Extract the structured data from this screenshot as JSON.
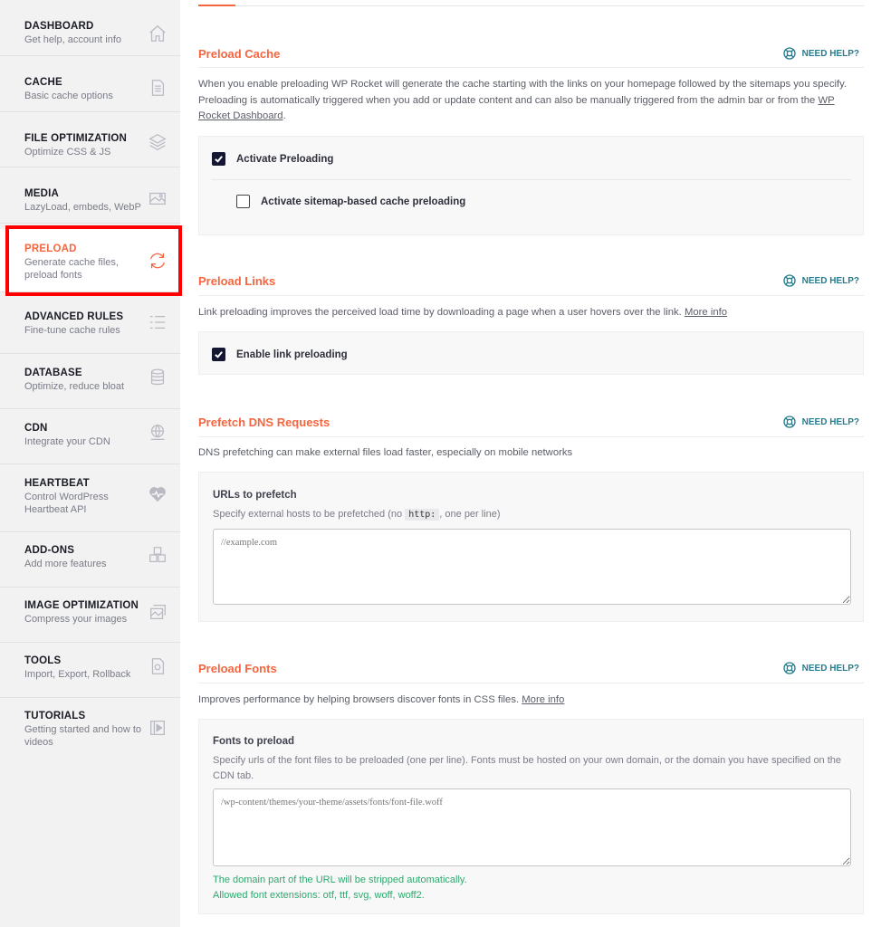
{
  "sidebar": {
    "items": [
      {
        "title": "DASHBOARD",
        "sub": "Get help, account info",
        "icon": "home-icon"
      },
      {
        "title": "CACHE",
        "sub": "Basic cache options",
        "icon": "document-icon"
      },
      {
        "title": "FILE OPTIMIZATION",
        "sub": "Optimize CSS & JS",
        "icon": "layers-icon"
      },
      {
        "title": "MEDIA",
        "sub": "LazyLoad, embeds, WebP",
        "icon": "image-icon"
      },
      {
        "title": "PRELOAD",
        "sub": "Generate cache files, preload fonts",
        "icon": "refresh-icon"
      },
      {
        "title": "ADVANCED RULES",
        "sub": "Fine-tune cache rules",
        "icon": "list-icon"
      },
      {
        "title": "DATABASE",
        "sub": "Optimize, reduce bloat",
        "icon": "database-icon"
      },
      {
        "title": "CDN",
        "sub": "Integrate your CDN",
        "icon": "globe-icon"
      },
      {
        "title": "HEARTBEAT",
        "sub": "Control WordPress Heartbeat API",
        "icon": "heart-pulse-icon"
      },
      {
        "title": "ADD-ONS",
        "sub": "Add more features",
        "icon": "cubes-icon"
      },
      {
        "title": "IMAGE OPTIMIZATION",
        "sub": "Compress your images",
        "icon": "image-compress-icon"
      },
      {
        "title": "TOOLS",
        "sub": "Import, Export, Rollback",
        "icon": "file-gear-icon"
      },
      {
        "title": "TUTORIALS",
        "sub": "Getting started and how to videos",
        "icon": "video-icon"
      }
    ],
    "active_index": 4
  },
  "help_label": "NEED HELP?",
  "preload_cache": {
    "title": "Preload Cache",
    "desc": "When you enable preloading WP Rocket will generate the cache starting with the links on your homepage followed by the sitemaps you specify. Preloading is automatically triggered when you add or update content and can also be manually triggered from the admin bar or from the ",
    "desc_link": "WP Rocket Dashboard",
    "desc_end": ".",
    "activate_label": "Activate Preloading",
    "activate_checked": true,
    "sitemap_label": "Activate sitemap-based cache preloading",
    "sitemap_checked": false
  },
  "preload_links": {
    "title": "Preload Links",
    "desc": "Link preloading improves the perceived load time by downloading a page when a user hovers over the link. ",
    "desc_link": "More info",
    "enable_label": "Enable link preloading",
    "enable_checked": true
  },
  "prefetch_dns": {
    "title": "Prefetch DNS Requests",
    "desc": "DNS prefetching can make external files load faster, especially on mobile networks",
    "field_label": "URLs to prefetch",
    "help_before": "Specify external hosts to be prefetched (no ",
    "help_code": "http:",
    "help_after": ", one per line)",
    "placeholder": "//example.com"
  },
  "preload_fonts": {
    "title": "Preload Fonts",
    "desc": "Improves performance by helping browsers discover fonts in CSS files. ",
    "desc_link": "More info",
    "field_label": "Fonts to preload",
    "help": "Specify urls of the font files to be preloaded (one per line). Fonts must be hosted on your own domain, or the domain you have specified on the CDN tab.",
    "placeholder": "/wp-content/themes/your-theme/assets/fonts/font-file.woff",
    "hint1": "The domain part of the URL will be stripped automatically.",
    "hint2": "Allowed font extensions: otf, ttf, svg, woff, woff2."
  }
}
